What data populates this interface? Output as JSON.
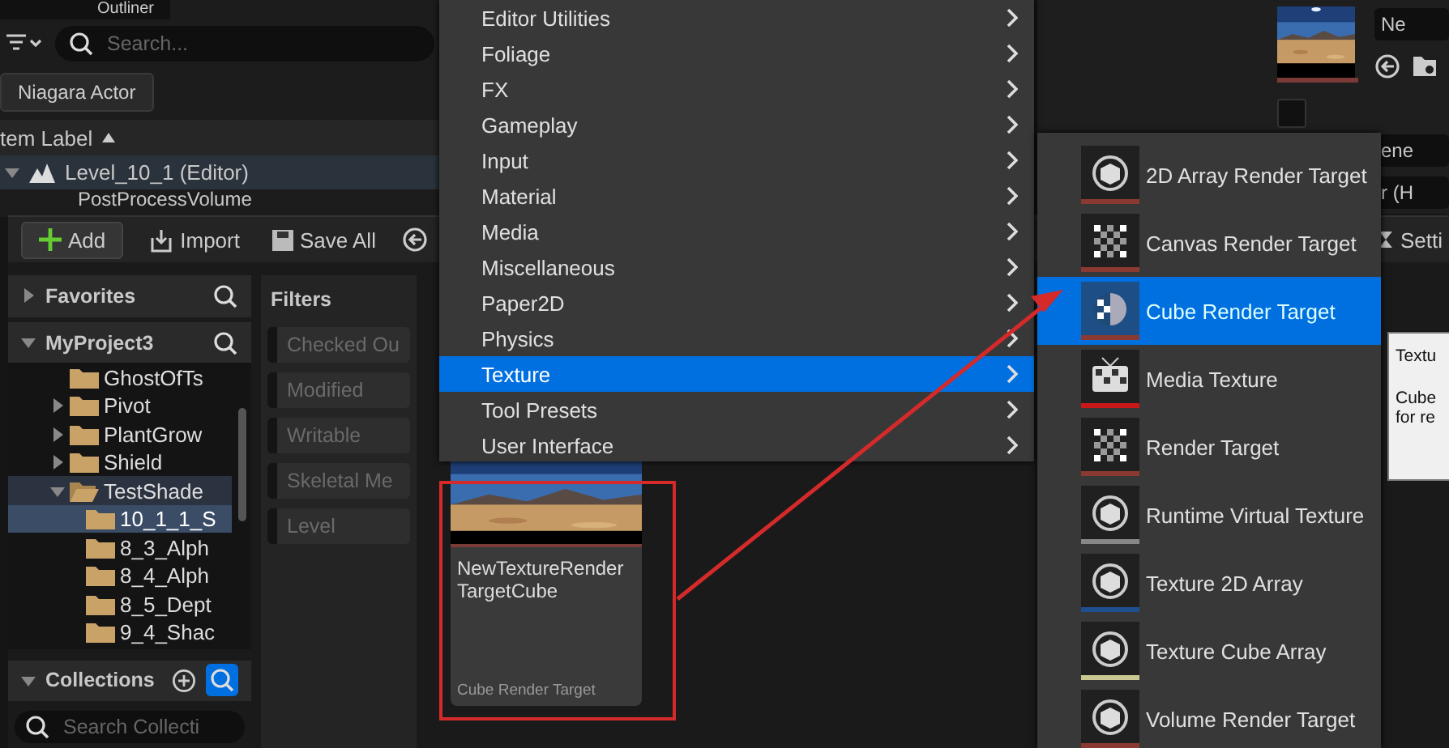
{
  "outliner": {
    "title": "Outliner",
    "search": {
      "placeholder": "Search..."
    },
    "filter_chip": "Niagara Actor",
    "column_header": "tem Label",
    "rows": [
      {
        "label": "Level_10_1 (Editor)",
        "expanded": true,
        "children": [
          {
            "label": "PostProcessVolume"
          }
        ]
      }
    ]
  },
  "details": {
    "dropdowns": [
      "Ne",
      "ene",
      "r (H"
    ],
    "checkbox": {
      "checked": false
    },
    "thumbnail": {
      "kind": "picture"
    }
  },
  "content_browser": {
    "toolbar": [
      "Add",
      "Import",
      "Save All"
    ],
    "settings_label": "Setti",
    "sources": {
      "favorites": {
        "label": "Favorites",
        "expanded": false
      },
      "project": {
        "label": "MyProject3",
        "expanded": true
      },
      "tree": [
        {
          "label": "GhostOfTs",
          "selected": false
        },
        {
          "label": "Pivot",
          "expanded": false,
          "selected": false
        },
        {
          "label": "PlantGrow",
          "expanded": false,
          "selected": false
        },
        {
          "label": "Shield",
          "expanded": false,
          "selected": false
        },
        {
          "label": "TestShade",
          "expanded": true,
          "selected": false,
          "children": [
            {
              "label": "10_1_1_S",
              "selected": true
            },
            {
              "label": "8_3_Alph",
              "selected": false
            },
            {
              "label": "8_4_Alph",
              "selected": false
            },
            {
              "label": "8_5_Dept",
              "selected": false
            },
            {
              "label": "9_4_Shac",
              "selected": false
            }
          ]
        }
      ],
      "collections": {
        "label": "Collections",
        "expanded": true,
        "search": {
          "placeholder": "Search Collecti"
        }
      }
    },
    "filters": {
      "title": "Filters",
      "items": [
        "Checked Ou",
        "Modified",
        "Writable",
        "Skeletal Me",
        "Level"
      ]
    },
    "asset": {
      "name_lines": [
        "NewTextureRender",
        "TargetCube"
      ],
      "type": "Cube Render Target",
      "thumbnail": {
        "kind": "picture"
      }
    }
  },
  "menu": {
    "items": [
      {
        "label": "Editor Utilities",
        "selected": false
      },
      {
        "label": "Foliage",
        "selected": false
      },
      {
        "label": "FX",
        "selected": false
      },
      {
        "label": "Gameplay",
        "selected": false
      },
      {
        "label": "Input",
        "selected": false
      },
      {
        "label": "Material",
        "selected": false
      },
      {
        "label": "Media",
        "selected": false
      },
      {
        "label": "Miscellaneous",
        "selected": false
      },
      {
        "label": "Paper2D",
        "selected": false
      },
      {
        "label": "Physics",
        "selected": false
      },
      {
        "label": "Texture",
        "selected": true
      },
      {
        "label": "Tool Presets",
        "selected": false
      },
      {
        "label": "User Interface",
        "selected": false
      }
    ]
  },
  "submenu": {
    "items": [
      {
        "label": "2D Array Render Target",
        "kind": "sphere",
        "color": "#8a3a30",
        "selected": false
      },
      {
        "label": "Canvas Render Target",
        "kind": "checker",
        "color": "#8a3a30",
        "selected": false
      },
      {
        "label": "Cube Render Target",
        "kind": "cube",
        "color": "#8a3a30",
        "selected": true
      },
      {
        "label": "Media Texture",
        "kind": "tv",
        "color": "#c81818",
        "selected": false
      },
      {
        "label": "Render Target",
        "kind": "checker",
        "color": "#8a3a30",
        "selected": false
      },
      {
        "label": "Runtime Virtual Texture",
        "kind": "sphere",
        "color": "#888888",
        "selected": false
      },
      {
        "label": "Texture 2D Array",
        "kind": "sphere",
        "color": "#1f4f8f",
        "selected": false
      },
      {
        "label": "Texture Cube Array",
        "kind": "sphere",
        "color": "#c8c890",
        "selected": false
      },
      {
        "label": "Volume Render Target",
        "kind": "sphere",
        "color": "#8a3a30",
        "selected": false
      }
    ]
  },
  "tooltip": {
    "title": "Textu",
    "lines": [
      "Cube",
      "for re"
    ]
  }
}
